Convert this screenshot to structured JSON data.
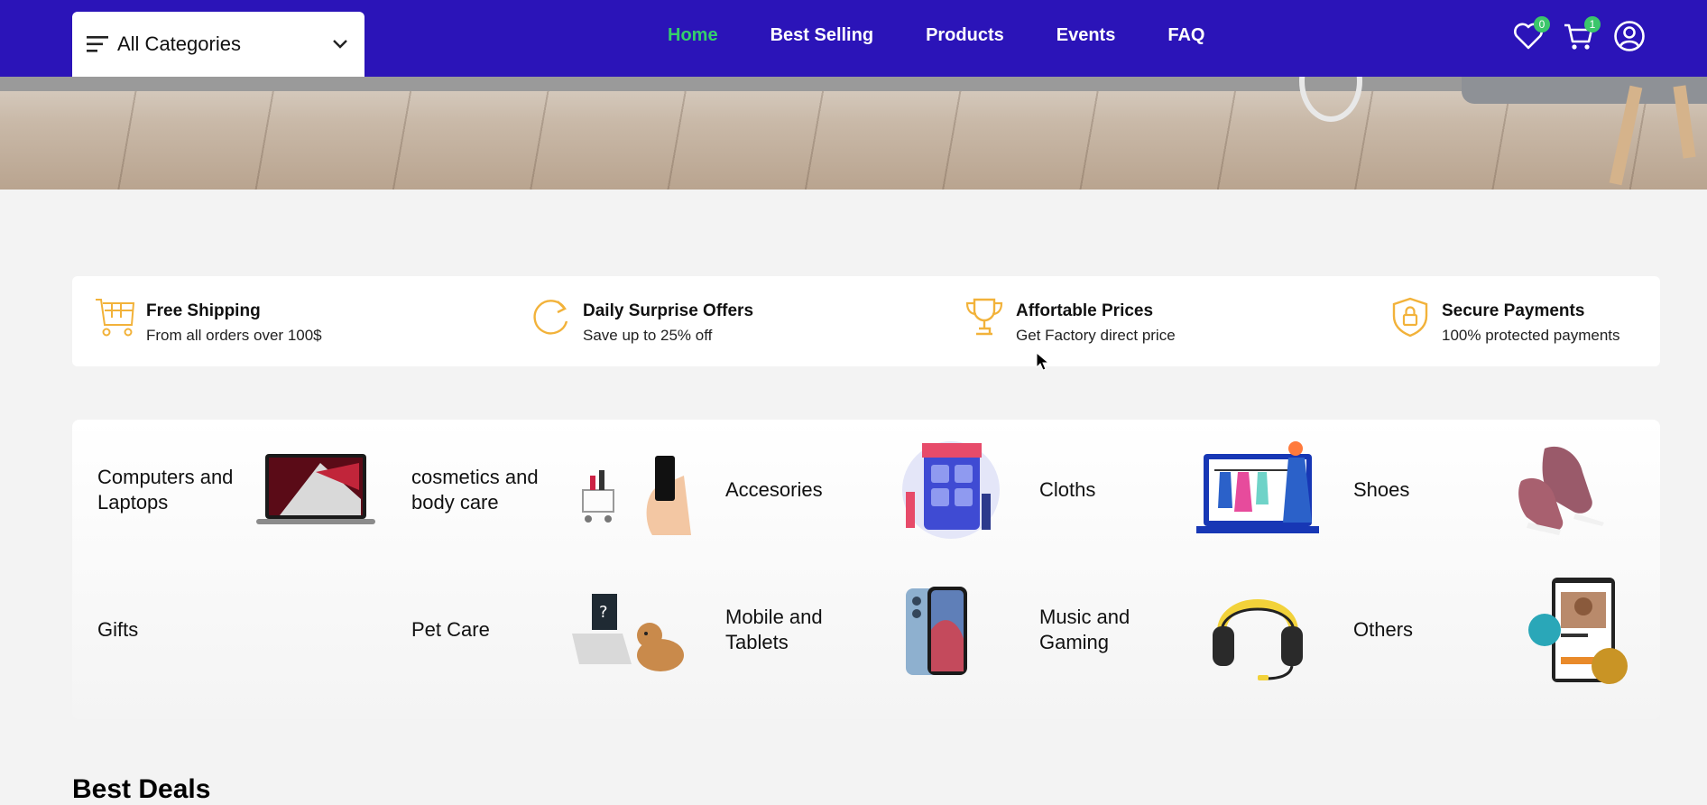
{
  "navbar": {
    "category_select": {
      "label": "All Categories",
      "icon": "menu-icon",
      "chevron": "chevron-down-icon"
    },
    "links": [
      {
        "label": "Home",
        "active": true
      },
      {
        "label": "Best Selling",
        "active": false
      },
      {
        "label": "Products",
        "active": false
      },
      {
        "label": "Events",
        "active": false
      },
      {
        "label": "FAQ",
        "active": false
      }
    ],
    "wishlist": {
      "icon": "heart-icon",
      "count": "0"
    },
    "cart": {
      "icon": "cart-icon",
      "count": "1"
    },
    "profile": {
      "icon": "user-icon"
    },
    "colors": {
      "bar": "#2b14b8",
      "active_link": "#34d06b",
      "badge": "#3bc66b"
    }
  },
  "features": [
    {
      "title": "Free Shipping",
      "subtitle": "From all orders over 100$",
      "icon": "shopping-cart-icon"
    },
    {
      "title": "Daily Surprise Offers",
      "subtitle": "Save up to 25% off",
      "icon": "refresh-icon"
    },
    {
      "title": "Affortable Prices",
      "subtitle": "Get Factory direct price",
      "icon": "trophy-icon"
    },
    {
      "title": "Secure Payments",
      "subtitle": "100% protected payments",
      "icon": "shield-lock-icon"
    }
  ],
  "feature_icon_color": "#f2b23a",
  "categories": [
    {
      "name": "Computers and Laptops",
      "image": "laptop-image"
    },
    {
      "name": "cosmetics and body care",
      "image": "cosmetics-image"
    },
    {
      "name": "Accesories",
      "image": "accessories-image"
    },
    {
      "name": "Cloths",
      "image": "cloths-image"
    },
    {
      "name": "Shoes",
      "image": "shoes-image"
    },
    {
      "name": "Gifts",
      "image": ""
    },
    {
      "name": "Pet Care",
      "image": "pet-care-image"
    },
    {
      "name": "Mobile and Tablets",
      "image": "phone-image"
    },
    {
      "name": "Music and Gaming",
      "image": "headphones-image"
    },
    {
      "name": "Others",
      "image": "others-image"
    }
  ],
  "best_deals": {
    "title": "Best Deals"
  }
}
